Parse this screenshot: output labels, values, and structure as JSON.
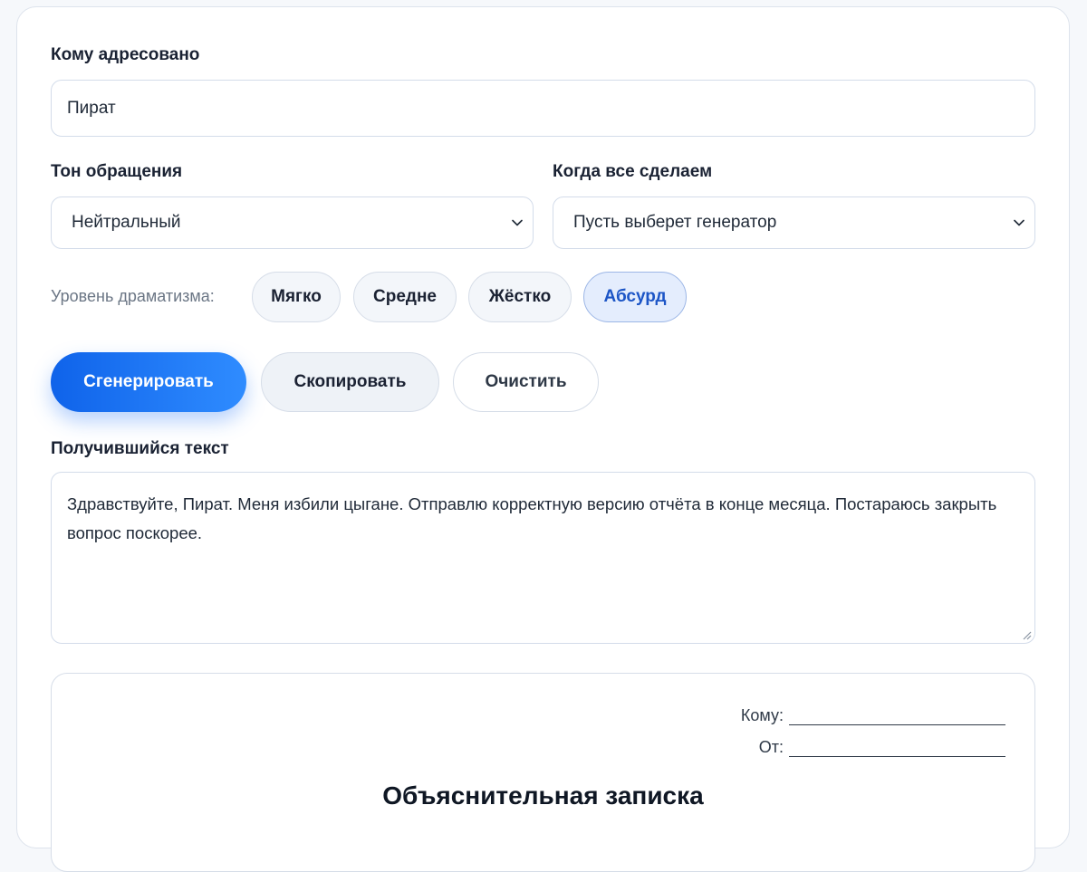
{
  "recipient": {
    "label": "Кому адресовано",
    "value": "Пират"
  },
  "tone": {
    "label": "Тон обращения",
    "value": "Нейтральный"
  },
  "when": {
    "label": "Когда все сделаем",
    "value": "Пусть выберет генератор"
  },
  "drama": {
    "label": "Уровень драматизма:",
    "options": [
      "Мягко",
      "Средне",
      "Жёстко",
      "Абсурд"
    ],
    "selected": "Абсурд"
  },
  "actions": {
    "generate": "Сгенерировать",
    "copy": "Скопировать",
    "clear": "Очистить"
  },
  "result": {
    "label": "Получившийся текст",
    "text": "Здравствуйте, Пират. Меня избили цыгане. Отправлю корректную версию отчёта в конце месяца. Постараюсь закрыть вопрос поскорее."
  },
  "document": {
    "to_label": "Кому:",
    "from_label": "От:",
    "title": "Объяснительная записка"
  },
  "colors": {
    "accent": "#1f74f3",
    "selected_pill_text": "#1c55c6"
  },
  "icons": {
    "select_arrow": "chevron-down-icon",
    "textarea_resize": "resize-handle-icon"
  }
}
